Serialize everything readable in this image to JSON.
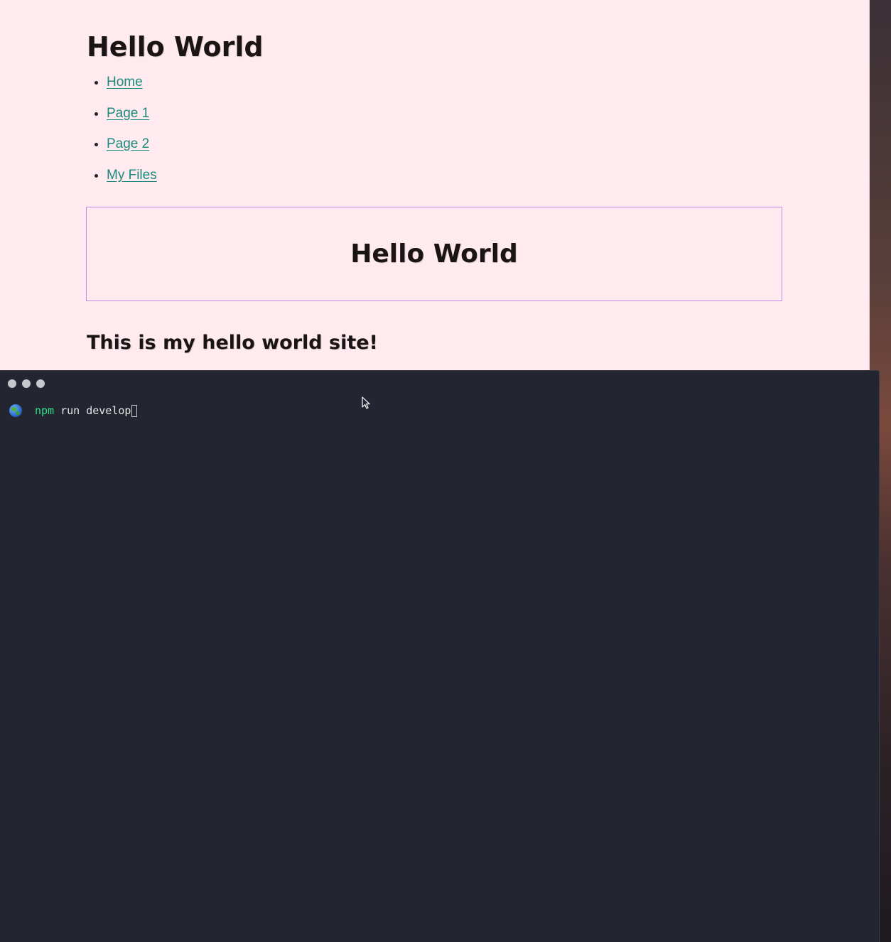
{
  "site": {
    "title": "Hello World",
    "nav": [
      {
        "label": "Home"
      },
      {
        "label": "Page 1"
      },
      {
        "label": "Page 2"
      },
      {
        "label": "My Files"
      }
    ],
    "hero_title": "Hello World",
    "subheading": "This is my hello world site!",
    "cutoff_text": "...."
  },
  "terminal": {
    "icon": "globe-icon",
    "command_keyword": "npm",
    "command_rest": "run develop"
  },
  "colors": {
    "page_bg": "#ffeaf0",
    "link": "#1a8a7a",
    "hero_border": "#c58ae8",
    "terminal_bg": "#232531",
    "terminal_keyword": "#35e08a"
  }
}
